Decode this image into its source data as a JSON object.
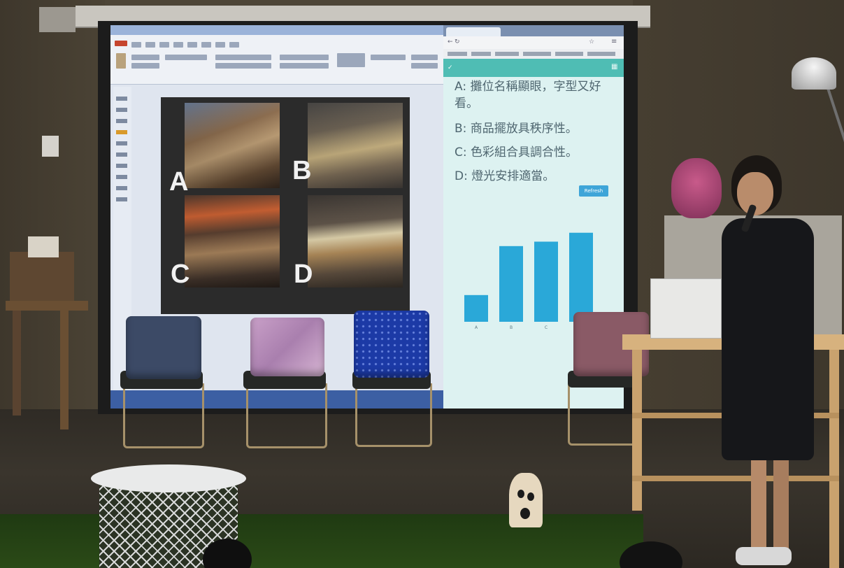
{
  "slide": {
    "letters": [
      "A",
      "B",
      "C",
      "D"
    ]
  },
  "browser": {
    "options": [
      "A: 攤位名稱顯眼，字型又好",
      "看。",
      "B: 商品擺放具秩序性。",
      "C: 色彩組合具調合性。",
      "D: 燈光安排適當。"
    ],
    "refresh_button": "Refresh"
  },
  "colors": {
    "bar_fill": "#2aa8d8",
    "app_bar": "#4fbdb4",
    "chart_background": "#ddf2f1"
  },
  "chart_data": {
    "type": "bar",
    "title": "",
    "xlabel": "",
    "ylabel": "",
    "categories": [
      "A",
      "B",
      "C",
      "D"
    ],
    "values": [
      6,
      17,
      18,
      20
    ],
    "ylim": [
      0,
      22
    ],
    "grid": false,
    "legend": "none"
  }
}
